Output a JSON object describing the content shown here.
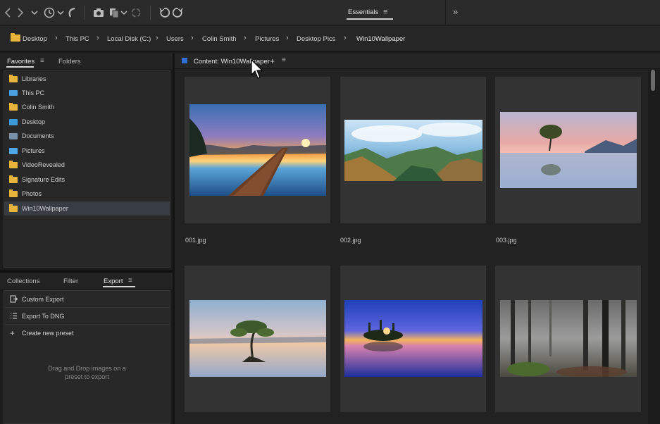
{
  "toolbar": {
    "icons": [
      "back-arrow-icon",
      "forward-arrow-icon",
      "recent-history-icon",
      "boomerang-icon",
      "camera-import-icon",
      "copy-stack-icon",
      "refine-icon",
      "rotate-left-icon",
      "rotate-right-icon"
    ],
    "workspace_label": "Essentials",
    "more_glyph": "»"
  },
  "breadcrumb": [
    "Desktop",
    "This PC",
    "Local Disk (C:)",
    "Users",
    "Colin Smith",
    "Pictures",
    "Desktop Pics",
    "Win10Wallpaper"
  ],
  "favorites_panel": {
    "tabs": [
      "Favorites",
      "Folders"
    ],
    "items": [
      {
        "label": "Libraries",
        "icon": "folder"
      },
      {
        "label": "This PC",
        "icon": "computer"
      },
      {
        "label": "Colin Smith",
        "icon": "folder"
      },
      {
        "label": "Desktop",
        "icon": "desktop"
      },
      {
        "label": "Documents",
        "icon": "documents"
      },
      {
        "label": "Pictures",
        "icon": "pictures"
      },
      {
        "label": "VideoRevealed",
        "icon": "folder"
      },
      {
        "label": "Signature Edits",
        "icon": "folder"
      },
      {
        "label": "Photos",
        "icon": "folder"
      },
      {
        "label": "Win10Wallpaper",
        "icon": "folder",
        "selected": true
      }
    ]
  },
  "export_panel": {
    "tabs": [
      "Collections",
      "Filter",
      "Export"
    ],
    "items": [
      {
        "label": "Custom Export",
        "icon": "export-icon"
      },
      {
        "label": "Export To DNG",
        "icon": "list-icon"
      },
      {
        "label": "Create new preset",
        "icon": "plus-icon"
      }
    ],
    "hint": "Drag and Drop images on a preset to export"
  },
  "content": {
    "title": "Content: Win10Wallpaper",
    "plus": "+",
    "menu": "≡",
    "files": [
      {
        "name": "001.jpg",
        "scene": "sunset pier over lake"
      },
      {
        "name": "002.jpg",
        "scene": "mountain panorama"
      },
      {
        "name": "003.jpg",
        "scene": "lone tree in lake"
      },
      {
        "name": "",
        "scene": "mangrove tree at dusk"
      },
      {
        "name": "",
        "scene": "island sunrise blue"
      },
      {
        "name": "",
        "scene": "misty forest"
      }
    ]
  },
  "colors": {
    "accent": "#2c6fd6",
    "folder": "#e9b43b",
    "selection": "#383d44"
  }
}
